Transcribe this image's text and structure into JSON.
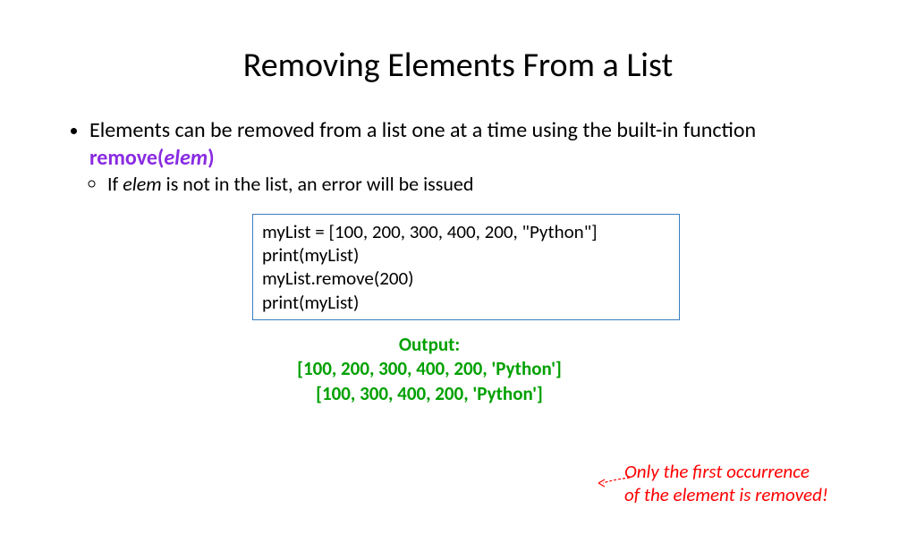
{
  "title": "Removing Elements From a List",
  "bullet1_prefix": "Elements can be removed from a list one at a time using the built-in function ",
  "func_call_open": "remove(",
  "func_call_arg": "elem",
  "func_call_close": ")",
  "sub1_prefix": "If ",
  "sub1_elem": "elem",
  "sub1_suffix": " is not in the list, an error will be issued",
  "code": {
    "line1": "myList = [100, 200, 300, 400, 200, \"Python\"]",
    "line2": "print(myList)",
    "line3": "myList.remove(200)",
    "line4": "print(myList)"
  },
  "output": {
    "label": "Output:",
    "line1": "[100, 200, 300, 400, 200, 'Python']",
    "line2": "[100, 300, 400, 200, 'Python']"
  },
  "note": {
    "line1": "Only the first occurrence",
    "line2": "of the element is removed!"
  }
}
